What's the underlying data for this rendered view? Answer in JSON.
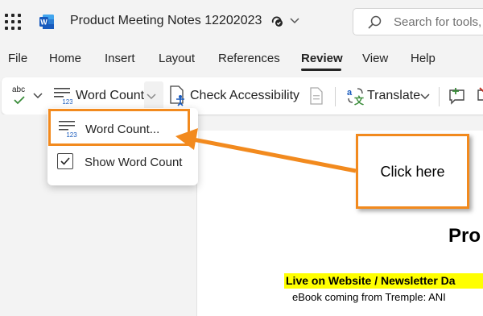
{
  "app": {
    "document_title": "Product Meeting Notes 12202023",
    "search_placeholder": "Search for tools,"
  },
  "menu": {
    "tabs": [
      "File",
      "Home",
      "Insert",
      "Layout",
      "References",
      "Review",
      "View",
      "Help"
    ],
    "active_tab": "Review"
  },
  "ribbon": {
    "spelling_icon_label": "abc",
    "word_count_label": "Word Count",
    "check_accessibility_label": "Check Accessibility",
    "translate_label": "Translate"
  },
  "dropdown": {
    "items": [
      {
        "label": "Word Count..."
      },
      {
        "label": "Show Word Count",
        "checked": true
      }
    ]
  },
  "callout": {
    "text": "Click here"
  },
  "document": {
    "heading": "Pro",
    "highlight_line": "Live on Website / Newsletter Da",
    "body_line": "eBook coming from Tremple: ANI"
  },
  "colors": {
    "accent_orange": "#f28a1e",
    "word_blue": "#185abd",
    "highlight_yellow": "#ffff00"
  }
}
